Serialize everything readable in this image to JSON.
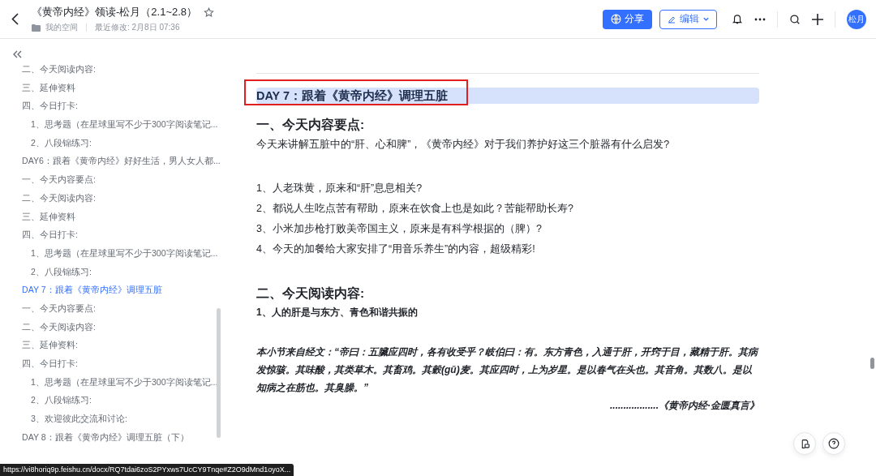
{
  "header": {
    "title": "《黄帝内经》领读-松月（2.1~2.8）",
    "starred": false,
    "location": "我的空间",
    "modified": "最近修改: 2月8日 07:36",
    "share_button": "分享",
    "edit_button": "编辑",
    "avatar": "松月"
  },
  "outline": [
    {
      "label": "二、今天阅读内容:",
      "selected": false
    },
    {
      "label": "三、延伸资料",
      "selected": false
    },
    {
      "label": "四、今日打卡:",
      "selected": false,
      "children": [
        {
          "label": "1、思考题（在星球里写不少于300字阅读笔记...",
          "selected": false
        },
        {
          "label": "2、八段锦练习:",
          "selected": false
        }
      ]
    },
    {
      "label": "DAY6：跟着《黄帝内经》好好生活，男人女人都...",
      "selected": false
    },
    {
      "label": "一、今天内容要点:",
      "selected": false
    },
    {
      "label": "二、今天阅读内容:",
      "selected": false
    },
    {
      "label": "三、延伸资料",
      "selected": false
    },
    {
      "label": "四、今日打卡:",
      "selected": false,
      "children": [
        {
          "label": "1、思考题（在星球里写不少于300字阅读笔记...",
          "selected": false
        },
        {
          "label": "2、八段锦练习:",
          "selected": false
        }
      ]
    },
    {
      "label": "DAY 7：跟着《黄帝内经》调理五脏",
      "selected": true
    },
    {
      "label": "一、今天内容要点:",
      "selected": false
    },
    {
      "label": "二、今天阅读内容:",
      "selected": false
    },
    {
      "label": "三、延伸资料:",
      "selected": false
    },
    {
      "label": "四、今日打卡:",
      "selected": false,
      "children": [
        {
          "label": "1、思考题（在星球里写不少于300字阅读笔记...",
          "selected": false
        },
        {
          "label": "2、八段锦练习:",
          "selected": false
        },
        {
          "label": "3、欢迎彼此交流和讨论:",
          "selected": false
        }
      ]
    },
    {
      "label": "DAY 8：跟着《黄帝内经》调理五脏（下）",
      "selected": false
    }
  ],
  "document": [
    {
      "kind": "day",
      "text": "DAY 7：跟着《黄帝内经》调理五脏",
      "marked": true
    },
    {
      "kind": "h2",
      "text": "一、今天内容要点:"
    },
    {
      "kind": "p",
      "text": "今天来讲解五脏中的“肝、心和脾”，《黄帝内经》对于我们养护好这三个脏器有什么启发?"
    },
    {
      "kind": "gap"
    },
    {
      "kind": "li",
      "text": "1、人老珠黄，原来和“肝”息息相关?"
    },
    {
      "kind": "li",
      "text": "2、都说人生吃点苦有帮助，原来在饮食上也是如此？苦能帮助长寿?"
    },
    {
      "kind": "li",
      "text": "3、小米加步枪打败美帝国主义，原来是有科学根据的（脾）?"
    },
    {
      "kind": "li",
      "text": "4、今天的加餐给大家安排了“用音乐养生”的内容，超级精彩!"
    },
    {
      "kind": "gap"
    },
    {
      "kind": "h2",
      "text": "二、今天阅读内容:"
    },
    {
      "kind": "bold",
      "text": "1、人的肝是与东方、青色和谐共振的"
    },
    {
      "kind": "gap"
    },
    {
      "kind": "quote",
      "text": "本小节来自经文：“帝曰：五臟应四时，各有收受乎？岐伯曰：有。东方青色，入通于肝，开窍于目，藏精于肝。其病发惊骇。其味酸，其类草木。其畜鸡。其穀(gǔ)麦。其应四时，上为岁星。是以春气在头也。其音角。其数八。是以知病之在筋也。其臭臊。”"
    },
    {
      "kind": "source",
      "text": "..................《黄帝内经·金匮真言》"
    }
  ],
  "status_url": "https://vi8horiq9p.feishu.cn/docx/RQ7tdai6zoS2PYxws7UcCY9Tnqe#Z2O9dMnd1oyoX..."
}
